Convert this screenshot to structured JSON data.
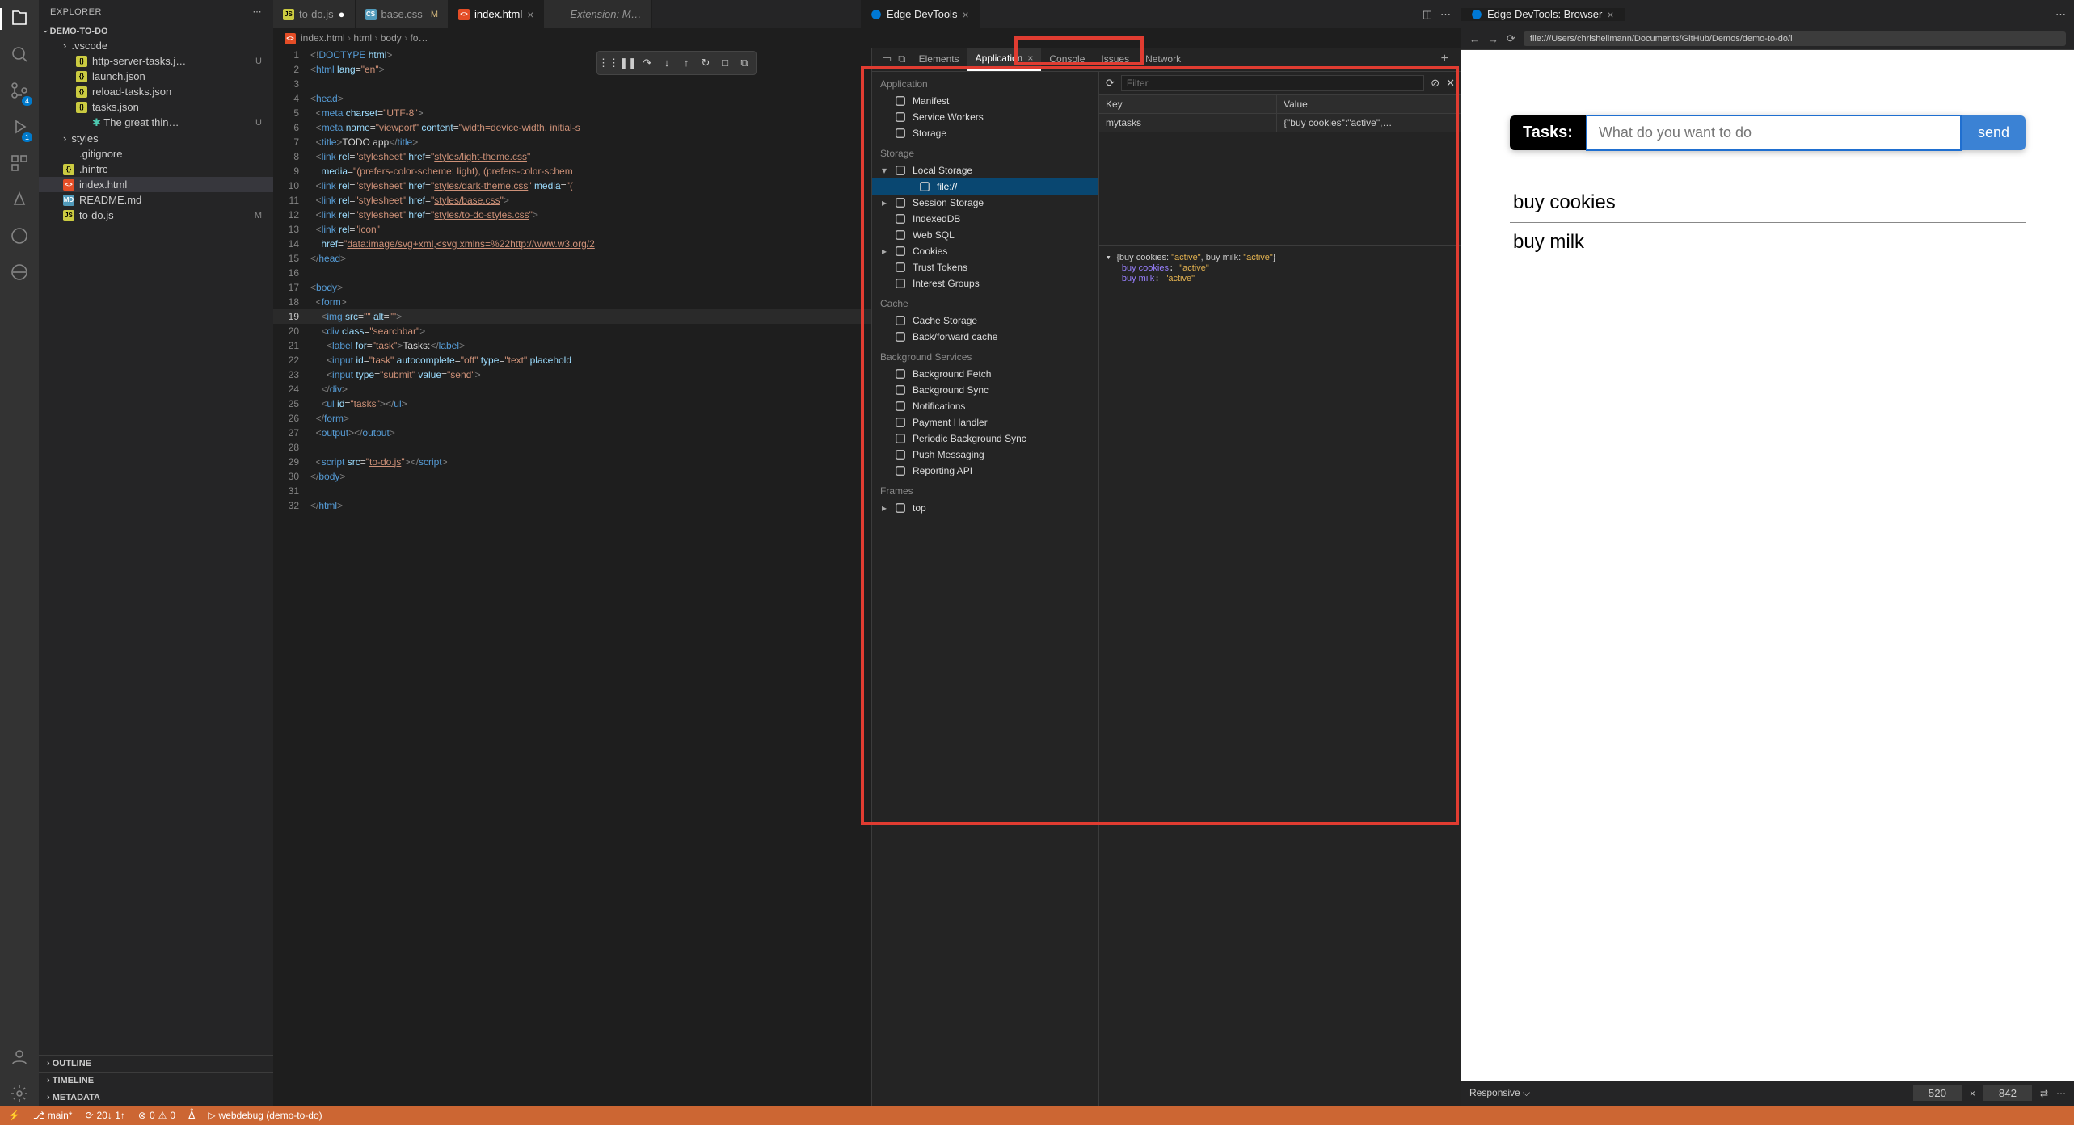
{
  "sidebar": {
    "title": "EXPLORER",
    "project": "DEMO-TO-DO",
    "files": [
      {
        "name": ".vscode",
        "type": "folder",
        "expanded": true
      },
      {
        "name": "http-server-tasks.j…",
        "type": "json",
        "indent": 1,
        "status": "U"
      },
      {
        "name": "launch.json",
        "type": "json",
        "indent": 1
      },
      {
        "name": "reload-tasks.json",
        "type": "json",
        "indent": 1
      },
      {
        "name": "tasks.json",
        "type": "json",
        "indent": 1
      },
      {
        "name": "The great thin…",
        "type": "text",
        "indent": 1,
        "status": "U",
        "prefix": "✱"
      },
      {
        "name": "styles",
        "type": "folder"
      },
      {
        "name": ".gitignore",
        "type": "text"
      },
      {
        "name": ".hintrc",
        "type": "json"
      },
      {
        "name": "index.html",
        "type": "html",
        "selected": true
      },
      {
        "name": "README.md",
        "type": "md"
      },
      {
        "name": "to-do.js",
        "type": "js",
        "status": "M"
      }
    ],
    "bottom": [
      "OUTLINE",
      "TIMELINE",
      "METADATA"
    ]
  },
  "tabs": {
    "editor": [
      {
        "label": "to-do.js",
        "icon": "js",
        "dirty": true
      },
      {
        "label": "base.css",
        "icon": "css",
        "mod": "M"
      },
      {
        "label": "index.html",
        "icon": "html",
        "active": true,
        "close": true
      },
      {
        "label": "Extension: M…",
        "icon": "ext",
        "italic": true
      }
    ],
    "devtools_tab": "Edge DevTools",
    "browser_tab": "Edge DevTools: Browser"
  },
  "breadcrumbs": [
    "index.html",
    "html",
    "body",
    "fo…"
  ],
  "code": [
    {
      "n": 1,
      "html": "<span class='t-pun'>&lt;!</span><span class='t-tag'>DOCTYPE</span> <span class='t-attr'>html</span><span class='t-pun'>&gt;</span>"
    },
    {
      "n": 2,
      "html": "<span class='t-pun'>&lt;</span><span class='t-tag'>html</span> <span class='t-attr'>lang</span>=<span class='t-str'>\"en\"</span><span class='t-pun'>&gt;</span>"
    },
    {
      "n": 3,
      "html": ""
    },
    {
      "n": 4,
      "html": "<span class='t-pun'>&lt;</span><span class='t-tag'>head</span><span class='t-pun'>&gt;</span>"
    },
    {
      "n": 5,
      "html": "  <span class='t-pun'>&lt;</span><span class='t-tag'>meta</span> <span class='t-attr'>charset</span>=<span class='t-str'>\"UTF-8\"</span><span class='t-pun'>&gt;</span>"
    },
    {
      "n": 6,
      "html": "  <span class='t-pun'>&lt;</span><span class='t-tag'>meta</span> <span class='t-attr'>name</span>=<span class='t-str'>\"viewport\"</span> <span class='t-attr'>content</span>=<span class='t-str'>\"width=device-width, initial-s</span>"
    },
    {
      "n": 7,
      "html": "  <span class='t-pun'>&lt;</span><span class='t-tag'>title</span><span class='t-pun'>&gt;</span><span class='t-text'>TODO app</span><span class='t-pun'>&lt;/</span><span class='t-tag'>title</span><span class='t-pun'>&gt;</span>"
    },
    {
      "n": 8,
      "html": "  <span class='t-pun'>&lt;</span><span class='t-tag'>link</span> <span class='t-attr'>rel</span>=<span class='t-str'>\"stylesheet\"</span> <span class='t-attr'>href</span>=<span class='t-str'>\"</span><span class='t-link'>styles/light-theme.css</span><span class='t-str'>\"</span>"
    },
    {
      "n": 9,
      "html": "    <span class='t-attr'>media</span>=<span class='t-str'>\"(prefers-color-scheme: light), (prefers-color-schem</span>"
    },
    {
      "n": 10,
      "html": "  <span class='t-pun'>&lt;</span><span class='t-tag'>link</span> <span class='t-attr'>rel</span>=<span class='t-str'>\"stylesheet\"</span> <span class='t-attr'>href</span>=<span class='t-str'>\"</span><span class='t-link'>styles/dark-theme.css</span><span class='t-str'>\"</span> <span class='t-attr'>media</span>=<span class='t-str'>\"(</span>"
    },
    {
      "n": 11,
      "html": "  <span class='t-pun'>&lt;</span><span class='t-tag'>link</span> <span class='t-attr'>rel</span>=<span class='t-str'>\"stylesheet\"</span> <span class='t-attr'>href</span>=<span class='t-str'>\"</span><span class='t-link'>styles/base.css</span><span class='t-str'>\"</span><span class='t-pun'>&gt;</span>"
    },
    {
      "n": 12,
      "html": "  <span class='t-pun'>&lt;</span><span class='t-tag'>link</span> <span class='t-attr'>rel</span>=<span class='t-str'>\"stylesheet\"</span> <span class='t-attr'>href</span>=<span class='t-str'>\"</span><span class='t-link'>styles/to-do-styles.css</span><span class='t-str'>\"</span><span class='t-pun'>&gt;</span>"
    },
    {
      "n": 13,
      "html": "  <span class='t-pun'>&lt;</span><span class='t-tag'>link</span> <span class='t-attr'>rel</span>=<span class='t-str'>\"icon\"</span>"
    },
    {
      "n": 14,
      "html": "    <span class='t-attr'>href</span>=<span class='t-str'>\"</span><span class='t-link'>data:image/svg+xml,&lt;svg xmlns=%22http://www.w3.org/2</span>"
    },
    {
      "n": 15,
      "html": "<span class='t-pun'>&lt;/</span><span class='t-tag'>head</span><span class='t-pun'>&gt;</span>"
    },
    {
      "n": 16,
      "html": ""
    },
    {
      "n": 17,
      "html": "<span class='t-pun'>&lt;</span><span class='t-tag'>body</span><span class='t-pun'>&gt;</span>"
    },
    {
      "n": 18,
      "html": "  <span class='t-pun'>&lt;</span><span class='t-tag'>form</span><span class='t-pun'>&gt;</span>"
    },
    {
      "n": 19,
      "html": "    <span class='t-pun'>&lt;</span><span class='t-tag'>img</span> <span class='t-attr'>src</span>=<span class='t-str'>\"\"</span> <span class='t-attr'>alt</span>=<span class='t-str'>\"\"</span><span class='t-pun'>&gt;</span>",
      "current": true
    },
    {
      "n": 20,
      "html": "    <span class='t-pun'>&lt;</span><span class='t-tag'>div</span> <span class='t-attr'>class</span>=<span class='t-str'>\"searchbar\"</span><span class='t-pun'>&gt;</span>"
    },
    {
      "n": 21,
      "html": "      <span class='t-pun'>&lt;</span><span class='t-tag'>label</span> <span class='t-attr'>for</span>=<span class='t-str'>\"task\"</span><span class='t-pun'>&gt;</span><span class='t-text'>Tasks:</span><span class='t-pun'>&lt;/</span><span class='t-tag'>label</span><span class='t-pun'>&gt;</span>"
    },
    {
      "n": 22,
      "html": "      <span class='t-pun'>&lt;</span><span class='t-tag'>input</span> <span class='t-attr'>id</span>=<span class='t-str'>\"task\"</span> <span class='t-attr'>autocomplete</span>=<span class='t-str'>\"off\"</span> <span class='t-attr'>type</span>=<span class='t-str'>\"text\"</span> <span class='t-attr'>placehold</span>"
    },
    {
      "n": 23,
      "html": "      <span class='t-pun'>&lt;</span><span class='t-tag'>input</span> <span class='t-attr'>type</span>=<span class='t-str'>\"submit\"</span> <span class='t-attr'>value</span>=<span class='t-str'>\"send\"</span><span class='t-pun'>&gt;</span>"
    },
    {
      "n": 24,
      "html": "    <span class='t-pun'>&lt;/</span><span class='t-tag'>div</span><span class='t-pun'>&gt;</span>"
    },
    {
      "n": 25,
      "html": "    <span class='t-pun'>&lt;</span><span class='t-tag'>ul</span> <span class='t-attr'>id</span>=<span class='t-str'>\"tasks\"</span><span class='t-pun'>&gt;&lt;/</span><span class='t-tag'>ul</span><span class='t-pun'>&gt;</span>"
    },
    {
      "n": 26,
      "html": "  <span class='t-pun'>&lt;/</span><span class='t-tag'>form</span><span class='t-pun'>&gt;</span>"
    },
    {
      "n": 27,
      "html": "  <span class='t-pun'>&lt;</span><span class='t-tag'>output</span><span class='t-pun'>&gt;&lt;/</span><span class='t-tag'>output</span><span class='t-pun'>&gt;</span>"
    },
    {
      "n": 28,
      "html": ""
    },
    {
      "n": 29,
      "html": "  <span class='t-pun'>&lt;</span><span class='t-tag'>script</span> <span class='t-attr'>src</span>=<span class='t-str'>\"</span><span class='t-link'>to-do.js</span><span class='t-str'>\"</span><span class='t-pun'>&gt;&lt;/</span><span class='t-tag'>script</span><span class='t-pun'>&gt;</span>"
    },
    {
      "n": 30,
      "html": "<span class='t-pun'>&lt;/</span><span class='t-tag'>body</span><span class='t-pun'>&gt;</span>"
    },
    {
      "n": 31,
      "html": ""
    },
    {
      "n": 32,
      "html": "<span class='t-pun'>&lt;/</span><span class='t-tag'>html</span><span class='t-pun'>&gt;</span>"
    }
  ],
  "devtools": {
    "tabs": [
      "Elements",
      "Application",
      "Console",
      "Issues",
      "Network"
    ],
    "active_tab": "Application",
    "filter_placeholder": "Filter",
    "groups": [
      {
        "title": "Application",
        "items": [
          {
            "l": "Manifest",
            "i": "doc"
          },
          {
            "l": "Service Workers",
            "i": "gear"
          },
          {
            "l": "Storage",
            "i": "db"
          }
        ]
      },
      {
        "title": "Storage",
        "items": [
          {
            "l": "Local Storage",
            "i": "grid",
            "exp": true,
            "chev": true
          },
          {
            "l": "file://",
            "i": "grid",
            "sub": true,
            "selected": true
          },
          {
            "l": "Session Storage",
            "i": "grid",
            "chev": true
          },
          {
            "l": "IndexedDB",
            "i": "db"
          },
          {
            "l": "Web SQL",
            "i": "db"
          },
          {
            "l": "Cookies",
            "i": "cookie",
            "chev": true
          },
          {
            "l": "Trust Tokens",
            "i": "doc"
          },
          {
            "l": "Interest Groups",
            "i": "doc"
          }
        ]
      },
      {
        "title": "Cache",
        "items": [
          {
            "l": "Cache Storage",
            "i": "db"
          },
          {
            "l": "Back/forward cache",
            "i": "db"
          }
        ]
      },
      {
        "title": "Background Services",
        "items": [
          {
            "l": "Background Fetch",
            "i": "sync"
          },
          {
            "l": "Background Sync",
            "i": "sync"
          },
          {
            "l": "Notifications",
            "i": "bell"
          },
          {
            "l": "Payment Handler",
            "i": "card"
          },
          {
            "l": "Periodic Background Sync",
            "i": "clock"
          },
          {
            "l": "Push Messaging",
            "i": "cloud"
          },
          {
            "l": "Reporting API",
            "i": "doc"
          }
        ]
      },
      {
        "title": "Frames",
        "items": [
          {
            "l": "top",
            "i": "frame",
            "chev": true
          }
        ]
      }
    ],
    "kv": {
      "key_header": "Key",
      "value_header": "Value",
      "rows": [
        {
          "k": "mytasks",
          "v": "{\"buy cookies\":\"active\",…"
        }
      ]
    },
    "object_preview": {
      "summary": "{buy cookies: \"active\", buy milk: \"active\"}",
      "entries": [
        {
          "k": "buy cookies",
          "v": "\"active\""
        },
        {
          "k": "buy milk",
          "v": "\"active\""
        }
      ]
    }
  },
  "browser": {
    "url": "file:///Users/chrisheilmann/Documents/GitHub/Demos/demo-to-do/i",
    "tasks_label": "Tasks:",
    "placeholder": "What do you want to do",
    "send": "send",
    "items": [
      "buy cookies",
      "buy milk"
    ],
    "responsive_label": "Responsive",
    "width": "520",
    "height": "842"
  },
  "status": {
    "branch": "main*",
    "sync": "20↓ 1↑",
    "errors": "0",
    "warnings": "0",
    "debug": "webdebug (demo-to-do)"
  }
}
